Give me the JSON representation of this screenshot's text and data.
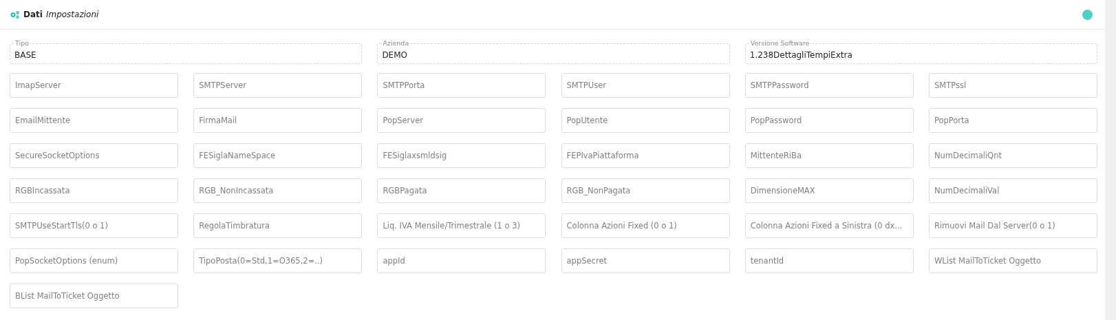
{
  "header": {
    "title": "Dati",
    "subtitle": "Impostazioni",
    "status": {
      "color": "#4fd1c5"
    }
  },
  "info_fields": [
    {
      "label": "Tipo",
      "value": "BASE"
    },
    {
      "label": "Azienda",
      "value": "DEMO"
    },
    {
      "label": "Versione Software",
      "value": "1.238DettagliTempiExtra"
    }
  ],
  "settings_fields": [
    {
      "placeholder": "ImapServer"
    },
    {
      "placeholder": "SMTPServer"
    },
    {
      "placeholder": "SMTPPorta"
    },
    {
      "placeholder": "SMTPUser"
    },
    {
      "placeholder": "SMTPPassword"
    },
    {
      "placeholder": "SMTPssl"
    },
    {
      "placeholder": "EmailMittente"
    },
    {
      "placeholder": "FirmaMail"
    },
    {
      "placeholder": "PopServer"
    },
    {
      "placeholder": "PopUtente"
    },
    {
      "placeholder": "PopPassword"
    },
    {
      "placeholder": "PopPorta"
    },
    {
      "placeholder": "SecureSocketOptions"
    },
    {
      "placeholder": "FESiglaNameSpace"
    },
    {
      "placeholder": "FESiglaxsmldsig"
    },
    {
      "placeholder": "FEPIvaPiattaforma"
    },
    {
      "placeholder": "MittenteRiBa"
    },
    {
      "placeholder": "NumDecimaliQnt"
    },
    {
      "placeholder": "RGBIncassata"
    },
    {
      "placeholder": "RGB_NonIncassata"
    },
    {
      "placeholder": "RGBPagata"
    },
    {
      "placeholder": "RGB_NonPagata"
    },
    {
      "placeholder": "DimensioneMAX"
    },
    {
      "placeholder": "NumDecimaliVal"
    },
    {
      "placeholder": "SMTPUseStartTls(0 o 1)"
    },
    {
      "placeholder": "RegolaTimbratura"
    },
    {
      "placeholder": "Liq. IVA Mensile/Trimestrale (1 o 3)"
    },
    {
      "placeholder": "Colonna Azioni Fixed (0 o 1)"
    },
    {
      "placeholder": "Colonna Azioni Fixed a Sinistra (0 dx..."
    },
    {
      "placeholder": "Rimuovi Mail Dal Server(0 o 1)"
    },
    {
      "placeholder": "PopSocketOptions (enum)"
    },
    {
      "placeholder": "TipoPosta(0=Std,1=O365,2=..)"
    },
    {
      "placeholder": "appId"
    },
    {
      "placeholder": "appSecret"
    },
    {
      "placeholder": "tenantId"
    },
    {
      "placeholder": "WList MailToTicket Oggetto"
    },
    {
      "placeholder": "BList MailToTicket Oggetto"
    }
  ]
}
